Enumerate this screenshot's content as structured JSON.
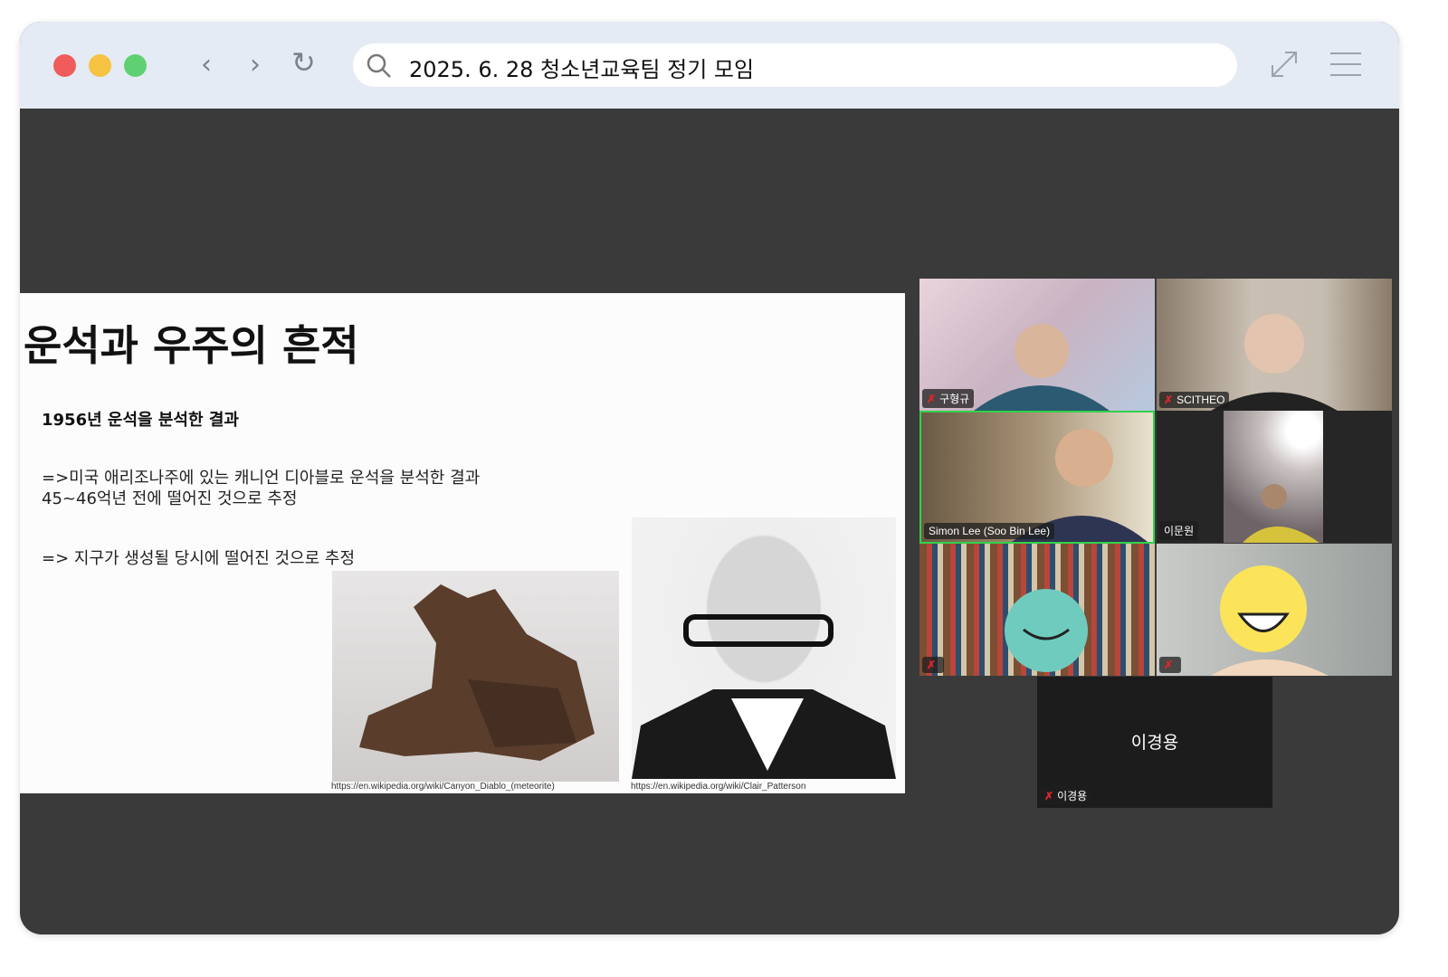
{
  "browser": {
    "url_text": "2025. 6. 28 청소년교육팀 정기 모임",
    "colors": {
      "close": "#f05c5c",
      "min": "#f5c242",
      "max": "#5fd173"
    }
  },
  "slide": {
    "title": "운석과 우주의 흔적",
    "subtitle": "1956년 운석을 분석한 결과",
    "para1": "=>미국 애리조나주에 있는 캐니언 디아블로 운석을 분석한 결과 45~46억년 전에 떨어진 것으로 추정",
    "para2": "=> 지구가 생성될 당시에 떨어진 것으로 추정",
    "caption1": "https://en.wikipedia.org/wiki/Canyon_Diablo_(meteorite)",
    "caption2": "https://en.wikipedia.org/wiki/Clair_Patterson"
  },
  "participants": [
    {
      "name": "구형규"
    },
    {
      "name": "SCITHEO"
    },
    {
      "name": "Simon Lee (Soo Bin Lee)"
    },
    {
      "name": "이문원"
    },
    {
      "name": ""
    },
    {
      "name": ""
    },
    {
      "name": "이경용",
      "center_label": "이경용"
    }
  ]
}
